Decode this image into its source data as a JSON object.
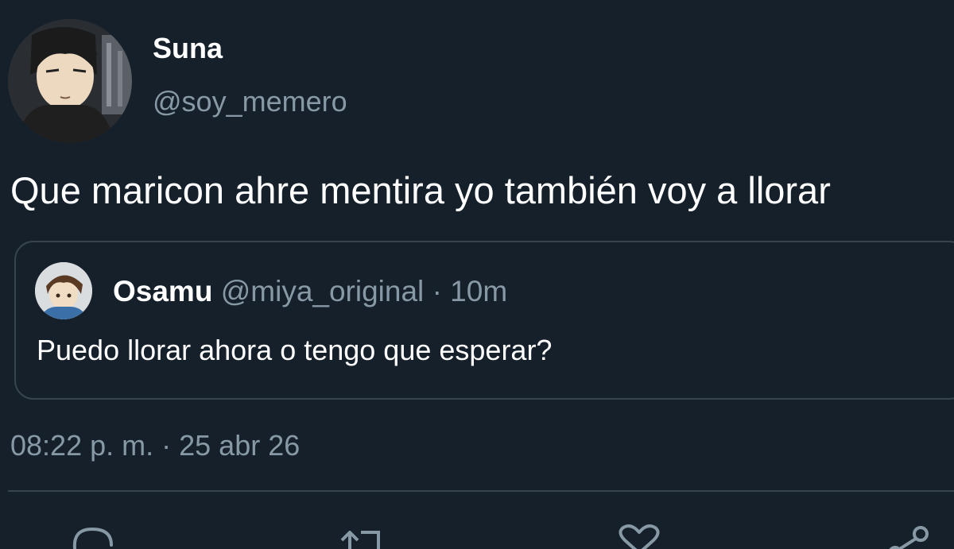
{
  "author": {
    "display_name": "Suna",
    "handle": "@soy_memero",
    "avatar_icon": "user-avatar-icon"
  },
  "tweet": {
    "text": "Que maricon ahre mentira yo también voy a llorar",
    "timestamp": "08:22 p. m.",
    "separator": "·",
    "date": "25 abr 26"
  },
  "quoted_tweet": {
    "display_name": "Osamu",
    "handle": "@miya_original",
    "separator": "·",
    "time_ago": "10m",
    "text": "Puedo llorar ahora o tengo que esperar?",
    "avatar_icon": "user-avatar-icon"
  },
  "actions": [
    {
      "icon": "reply-icon"
    },
    {
      "icon": "retweet-icon"
    },
    {
      "icon": "like-icon"
    },
    {
      "icon": "share-icon"
    }
  ],
  "colors": {
    "background": "#15202b",
    "primary_text": "#ffffff",
    "secondary_text": "#8899a6",
    "border": "#38444d"
  }
}
